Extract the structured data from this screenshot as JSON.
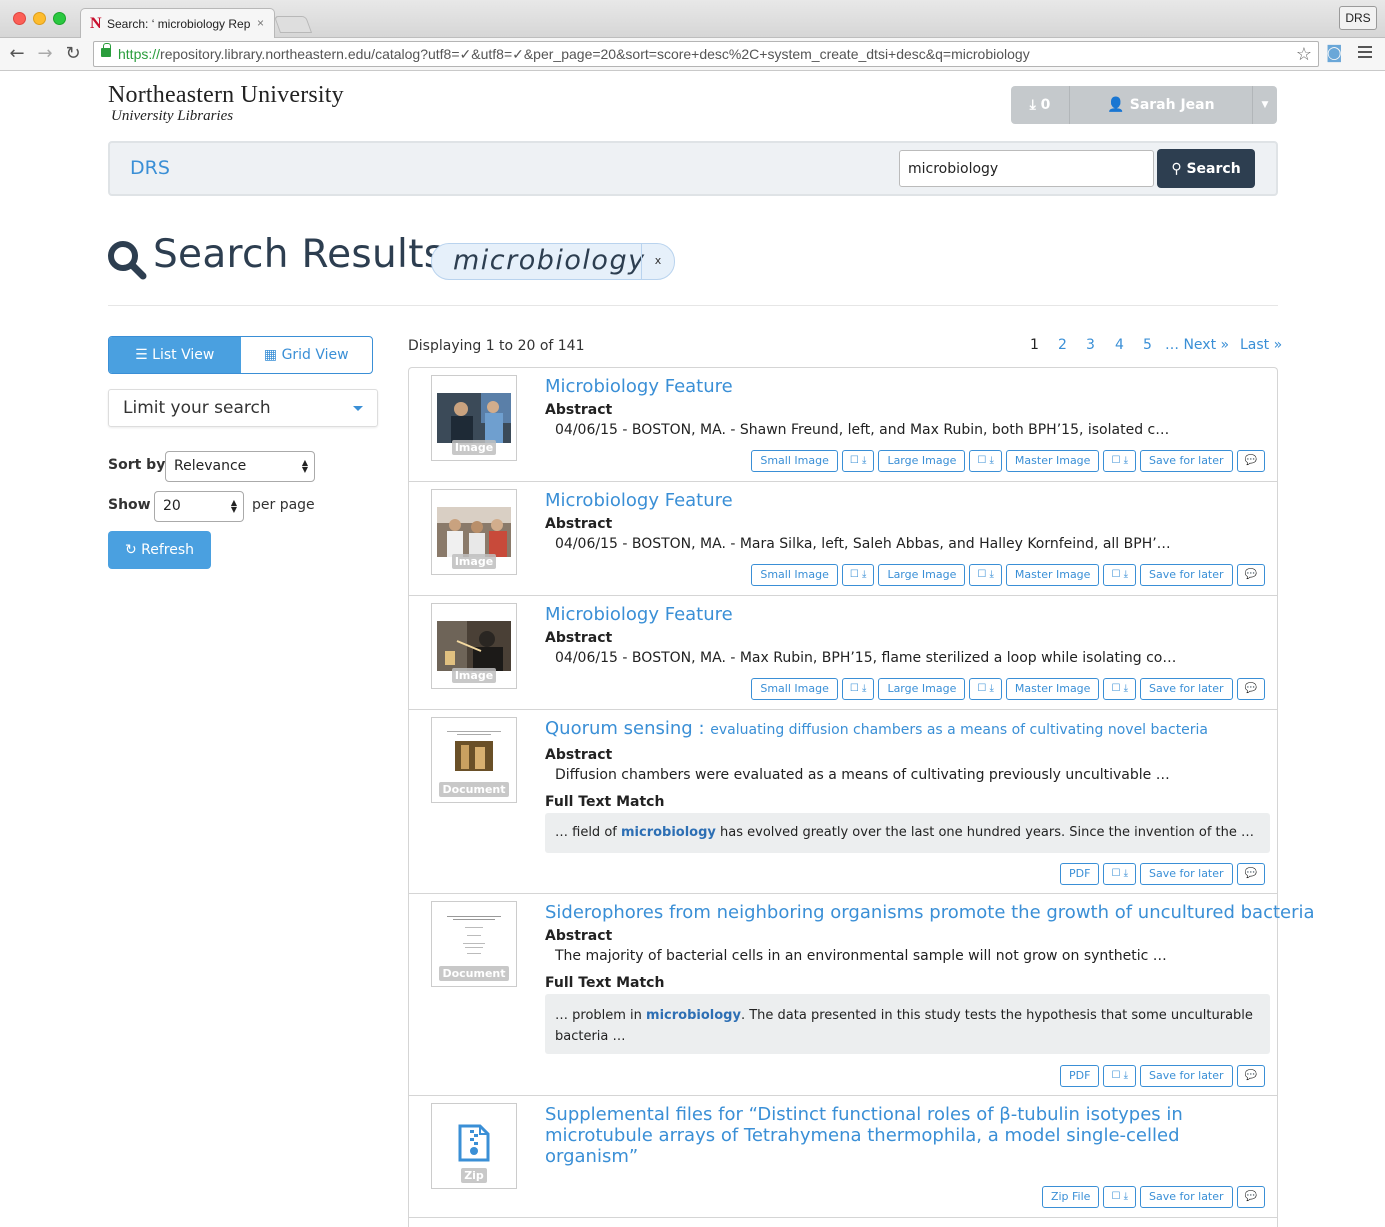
{
  "browser": {
    "tab_title": "Search: ‘ microbiology Rep",
    "tab_close": "×",
    "profile_badge": "DRS",
    "url_scheme": "https://",
    "url_rest": "repository.library.northeastern.edu/catalog?utf8=✓&utf8=✓&per_page=20&sort=score+desc%2C+system_create_dtsi+desc&q=microbiology"
  },
  "header": {
    "logo_main": "Northeastern University",
    "logo_sub": "University Libraries",
    "download_count": "⤓ 0",
    "user_name": "Sarah Jean Sweeney",
    "brand": "DRS",
    "search_value": "microbiology",
    "search_button": "Search"
  },
  "heading": {
    "title": "Search Results",
    "query": "microbiology",
    "remove": "x"
  },
  "sidebar": {
    "list_view": "List View",
    "grid_view": "Grid View",
    "limit_search": "Limit your search",
    "sort_label": "Sort by",
    "sort_value": "Relevance",
    "show_label": "Show",
    "show_value": "20",
    "per_page": "per page",
    "refresh": "Refresh"
  },
  "results_header": {
    "displaying": "Displaying 1 to 20 of 141",
    "pages": [
      "1",
      "2",
      "3",
      "4",
      "5"
    ],
    "ellipsis_next": "… Next »",
    "last": "Last »"
  },
  "labels": {
    "abstract": "Abstract",
    "full_text_match": "Full Text Match",
    "save_for_later": "Save for later",
    "small_image": "Small Image",
    "large_image": "Large Image",
    "master_image": "Master Image",
    "pdf": "PDF",
    "zip_file": "Zip File",
    "download_toggle": "☐ ⤓",
    "comment_icon": "💬"
  },
  "results": [
    {
      "title": "Microbiology Feature",
      "type": "Image",
      "abstract": "04/06/15 - BOSTON, MA. - Shawn Freund, left, and Max Rubin, both BPH’15, isolated c…"
    },
    {
      "title": "Microbiology Feature",
      "type": "Image",
      "abstract": "04/06/15 - BOSTON, MA. - Mara Silka, left, Saleh Abbas, and Halley Kornfeind, all BPH’…"
    },
    {
      "title": "Microbiology Feature",
      "type": "Image",
      "abstract": "04/06/15 - BOSTON, MA. - Max Rubin, BPH’15, flame sterilized a loop while isolating co…"
    },
    {
      "title": "Quorum sensing :",
      "subtitle": "evaluating diffusion chambers as a means of cultivating novel bacteria",
      "type": "Document",
      "abstract": "Diffusion chambers were evaluated as a means of cultivating previously uncultivable …",
      "ft_before": "… field of ",
      "ft_highlight": "microbiology",
      "ft_after": " has evolved greatly over the last one hundred years. Since the invention of the …"
    },
    {
      "title": "Siderophores from neighboring organisms promote the growth of uncultured bacteria",
      "type": "Document",
      "abstract": "The majority of bacterial cells in an environmental sample will not grow on synthetic …",
      "ft_before": "… problem in ",
      "ft_highlight": "microbiology",
      "ft_after": ". The data presented in this study tests the hypothesis that some unculturable bacteria …"
    },
    {
      "title": "Supplemental files for “Distinct functional roles of β-tubulin isotypes in microtubule arrays of Tetrahymena thermophila, a model single-celled organism”",
      "type": "Zip"
    }
  ],
  "colors": {
    "link": "#3a8fd6",
    "navy": "#2d3e50",
    "primary": "#4aa0e0"
  }
}
